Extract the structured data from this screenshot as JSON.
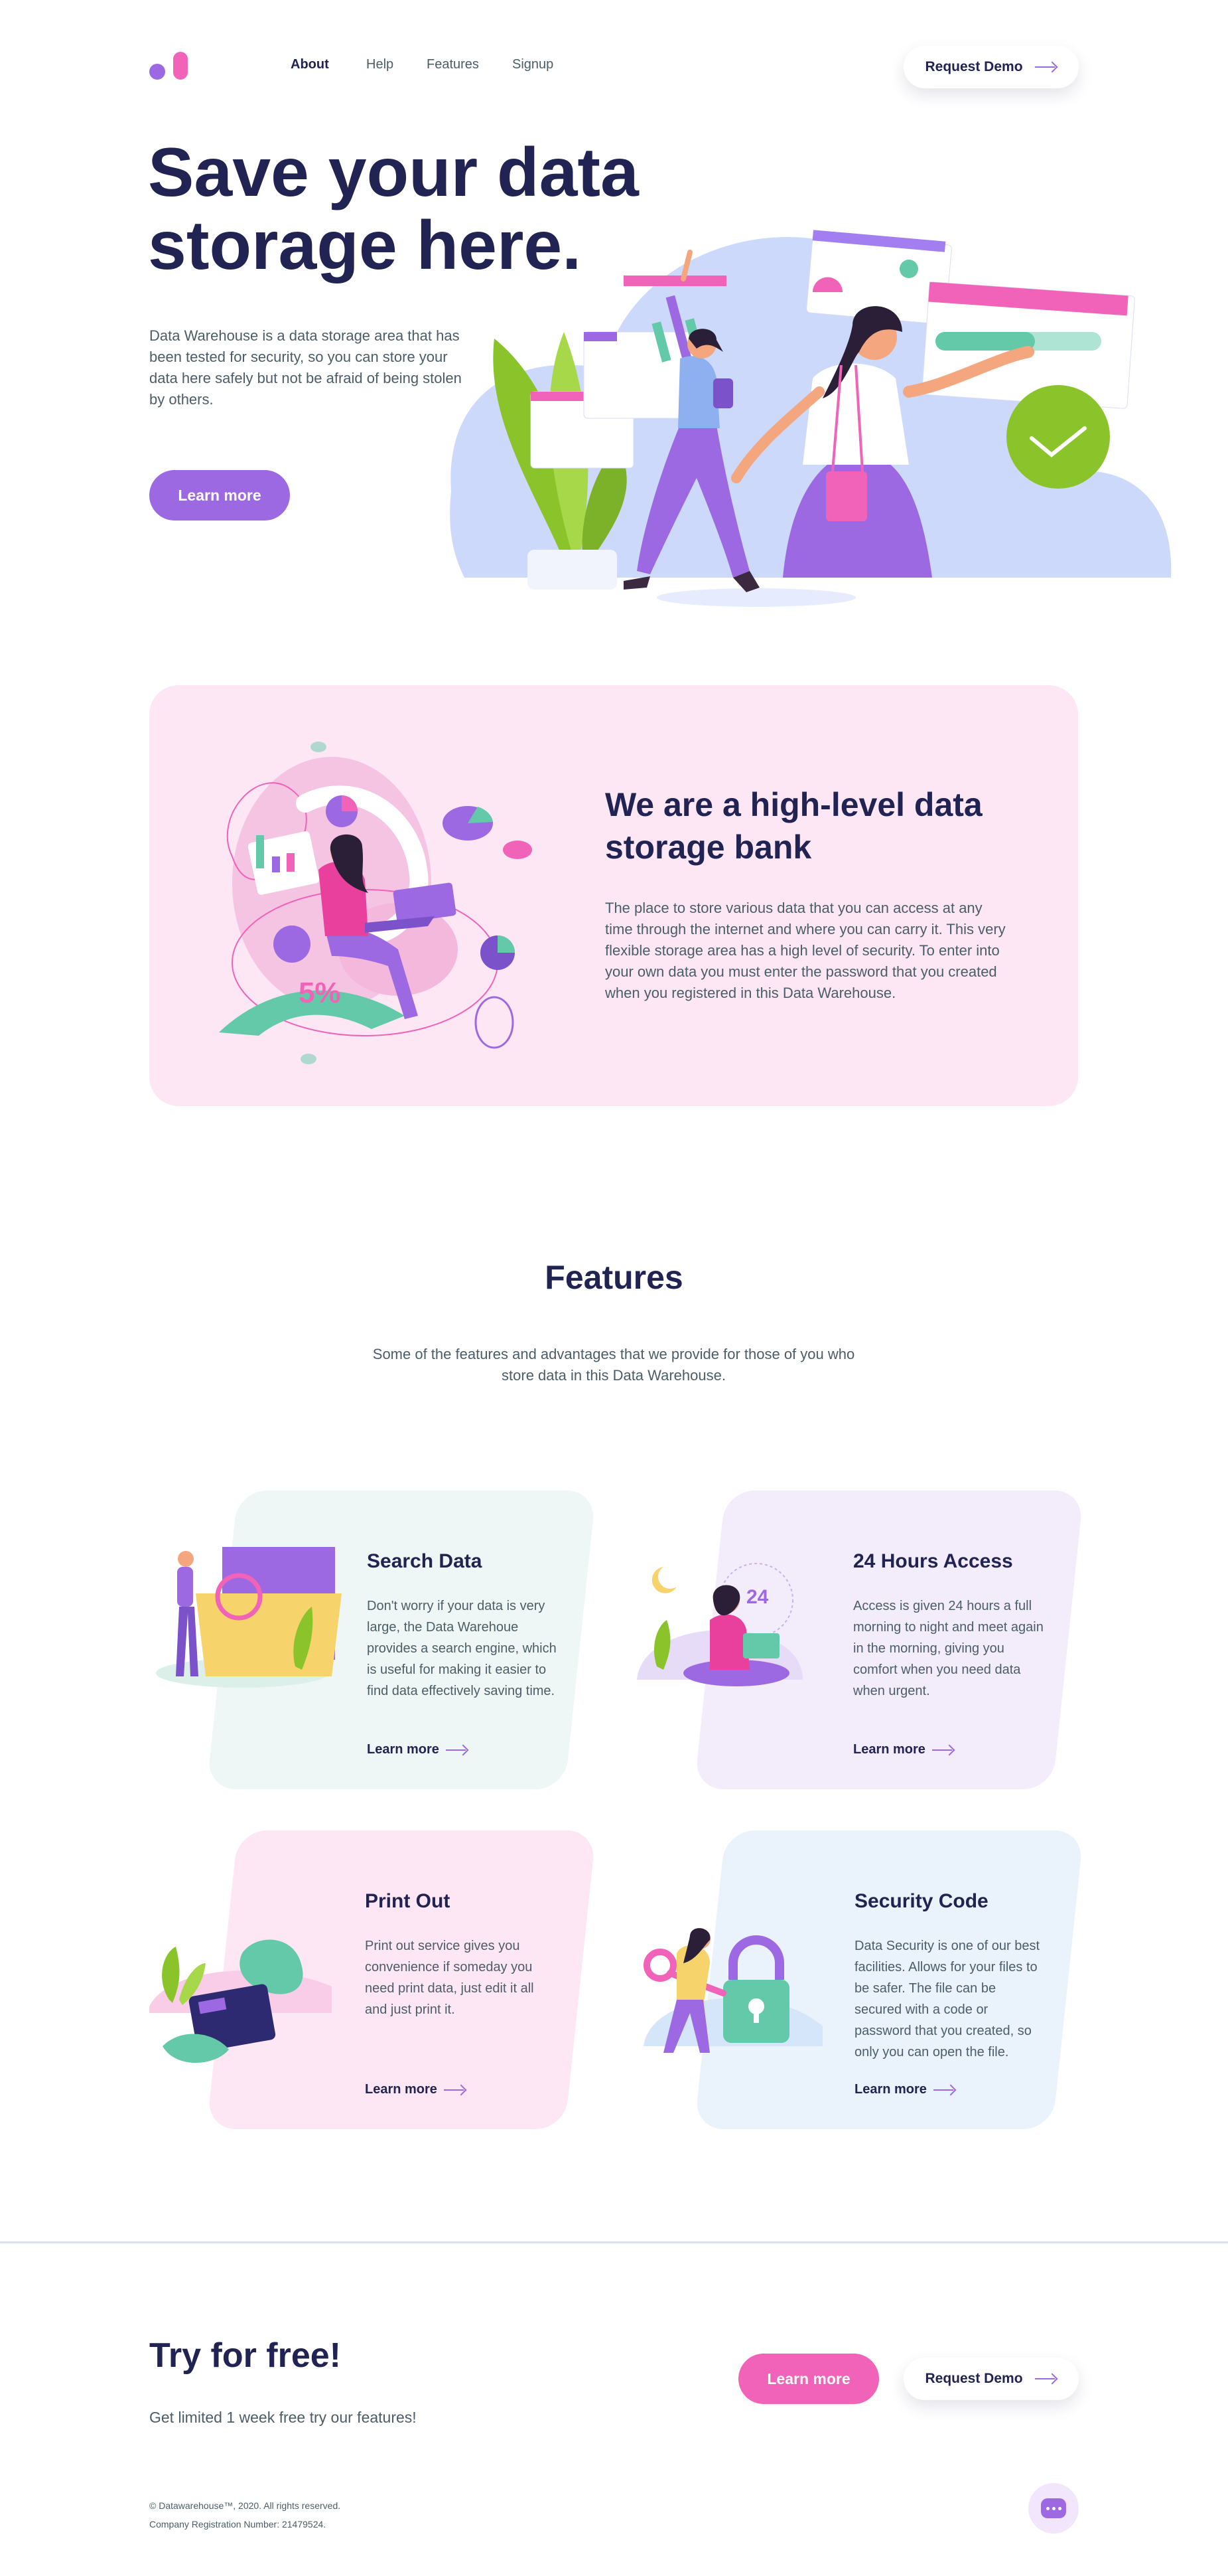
{
  "header": {
    "nav": [
      "About",
      "Help",
      "Features",
      "Signup"
    ],
    "request_demo": "Request Demo"
  },
  "hero": {
    "title_line1": "Save your data",
    "title_line2": "storage here.",
    "text": "Data Warehouse is a data storage area that has been tested for security, so you can store your data here safely but not be afraid of being stolen by others.",
    "learn_more": "Learn more"
  },
  "bank": {
    "title": "We are a high-level data storage bank",
    "text": "The place to store various data that you can access at any time through the internet and where you can carry it. This very flexible storage area has a high level of security. To enter into your own data you must enter the password that you created when you registered in this Data Warehouse.",
    "illustration_label": "5%"
  },
  "features": {
    "title": "Features",
    "subtitle": "Some of the features and advantages that we provide for those of you who store data in this Data Warehouse.",
    "cards": [
      {
        "title": "Search Data",
        "text": "Don't worry if your data is very large, the Data Warehoue provides a search engine, which is useful for making it easier to find data effectively saving time.",
        "link": "Learn more",
        "color": "#eef7f5"
      },
      {
        "title": "24 Hours Access",
        "text": "Access is given 24 hours a full morning to night and meet again in the morning, giving you comfort when you need data when urgent.",
        "link": "Learn more",
        "color": "#f3ecfb",
        "illustration_label": "24"
      },
      {
        "title": "Print Out",
        "text": "Print out service gives you convenience if someday you need print data, just edit it all and just print it.",
        "link": "Learn more",
        "color": "#fde7f4"
      },
      {
        "title": "Security Code",
        "text": "Data Security is one of our best facilities. Allows for your files to be safer. The file can be secured with a code or password that you created, so only you can open the file.",
        "link": "Learn more",
        "color": "#eaf3fb"
      }
    ]
  },
  "cta": {
    "title": "Try for free!",
    "subtitle": "Get limited 1 week free try our features!",
    "learn_more": "Learn more",
    "request_demo": "Request Demo"
  },
  "footer": {
    "copyright": "© Datawarehouse™, 2020. All rights reserved.",
    "registration": "Company Registration Number: 21479524."
  },
  "colors": {
    "navy": "#212353",
    "purple": "#9c69e2",
    "pink": "#f063b8",
    "teal": "#63c9a9",
    "green": "#8bc32a",
    "text_gray": "#4b5d68"
  }
}
